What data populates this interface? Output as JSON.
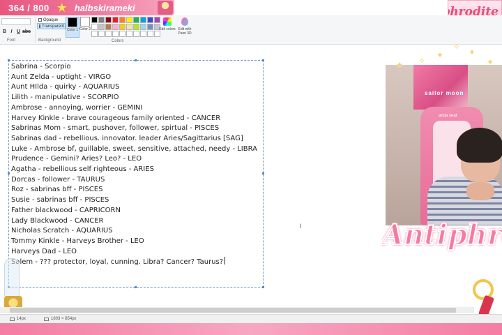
{
  "overlay": {
    "sub_counter": "364 / 800",
    "channel_name": "halbskirameki",
    "logo_small": "Antiphrodite",
    "logo_text": "Antiphroa",
    "cam_poster_text": "sailor moon",
    "cam_chair_label": "anda seat"
  },
  "ribbon": {
    "font_label": "Font",
    "background_label": "Background",
    "opaque_label": "Opaque",
    "transparent_label": "Transparent",
    "color1_label": "Color 1",
    "color2_label": "Color 2",
    "colors_label": "Colors",
    "edit_colors_label": "Edit colors",
    "edit_3d_label": "Edit with Paint 3D",
    "font_buttons": [
      "B",
      "I",
      "U",
      "abc"
    ],
    "color1": "#000000",
    "color2": "#ffffff",
    "palette": [
      "#000000",
      "#7f7f7f",
      "#880015",
      "#ed1c24",
      "#ff7f27",
      "#fff200",
      "#22b14c",
      "#00a2e8",
      "#3f48cc",
      "#a349a4",
      "#ffffff",
      "#c3c3c3",
      "#b97a57",
      "#ffaec9",
      "#ffc90e",
      "#efe4b0",
      "#b5e61d",
      "#99d9ea",
      "#7092be",
      "#c8bfe7",
      "#ffffff",
      "#ffffff",
      "#ffffff",
      "#ffffff",
      "#ffffff",
      "#ffffff",
      "#ffffff",
      "#ffffff",
      "#ffffff",
      "#ffffff"
    ]
  },
  "document": {
    "lines": [
      "Sabrina - Scorpio",
      "Aunt Zelda - uptight - VIRGO",
      "Aunt HIlda - quirky - AQUARIUS",
      "Lilith - manipulative - SCORPIO",
      "Ambrose - annoying, worrier - GEMINI",
      "Harvey Kinkle - brave courageous family oriented - CANCER",
      "Sabrinas Mom - smart, pushover, follower, spirtual - PISCES",
      "Sabrinas dad - rebellious. innovator. leader Aries/Sagittarius [SAG]",
      "Luke - Ambrose bf, guillable, sweet, sensitive, attached, needy - LIBRA",
      "Prudence - Gemini? Aries? Leo? - LEO",
      "Agatha - rebellious self righteous - ARIES",
      "Dorcas - follower - TAURUS",
      "Roz - sabrinas bff - PISCES",
      "Susie - sabrinas bff - PISCES",
      "Father blackwood - CAPRICORN",
      "Lady Blackwood - CANCER",
      "Nicholas Scratch - AQUARIUS",
      "Tommy Kinkle - Harveys Brother - LEO",
      "Harveys Dad - LEO",
      "Salem - ??? protector, loyal, cunning. Libra? Cancer? Taurus?"
    ]
  },
  "status": {
    "cursor_pos": "14px",
    "canvas_size": "1803 × 854px"
  },
  "colors": {
    "accent_pink": "#e8567e",
    "selection_blue": "#6f9bd1"
  }
}
